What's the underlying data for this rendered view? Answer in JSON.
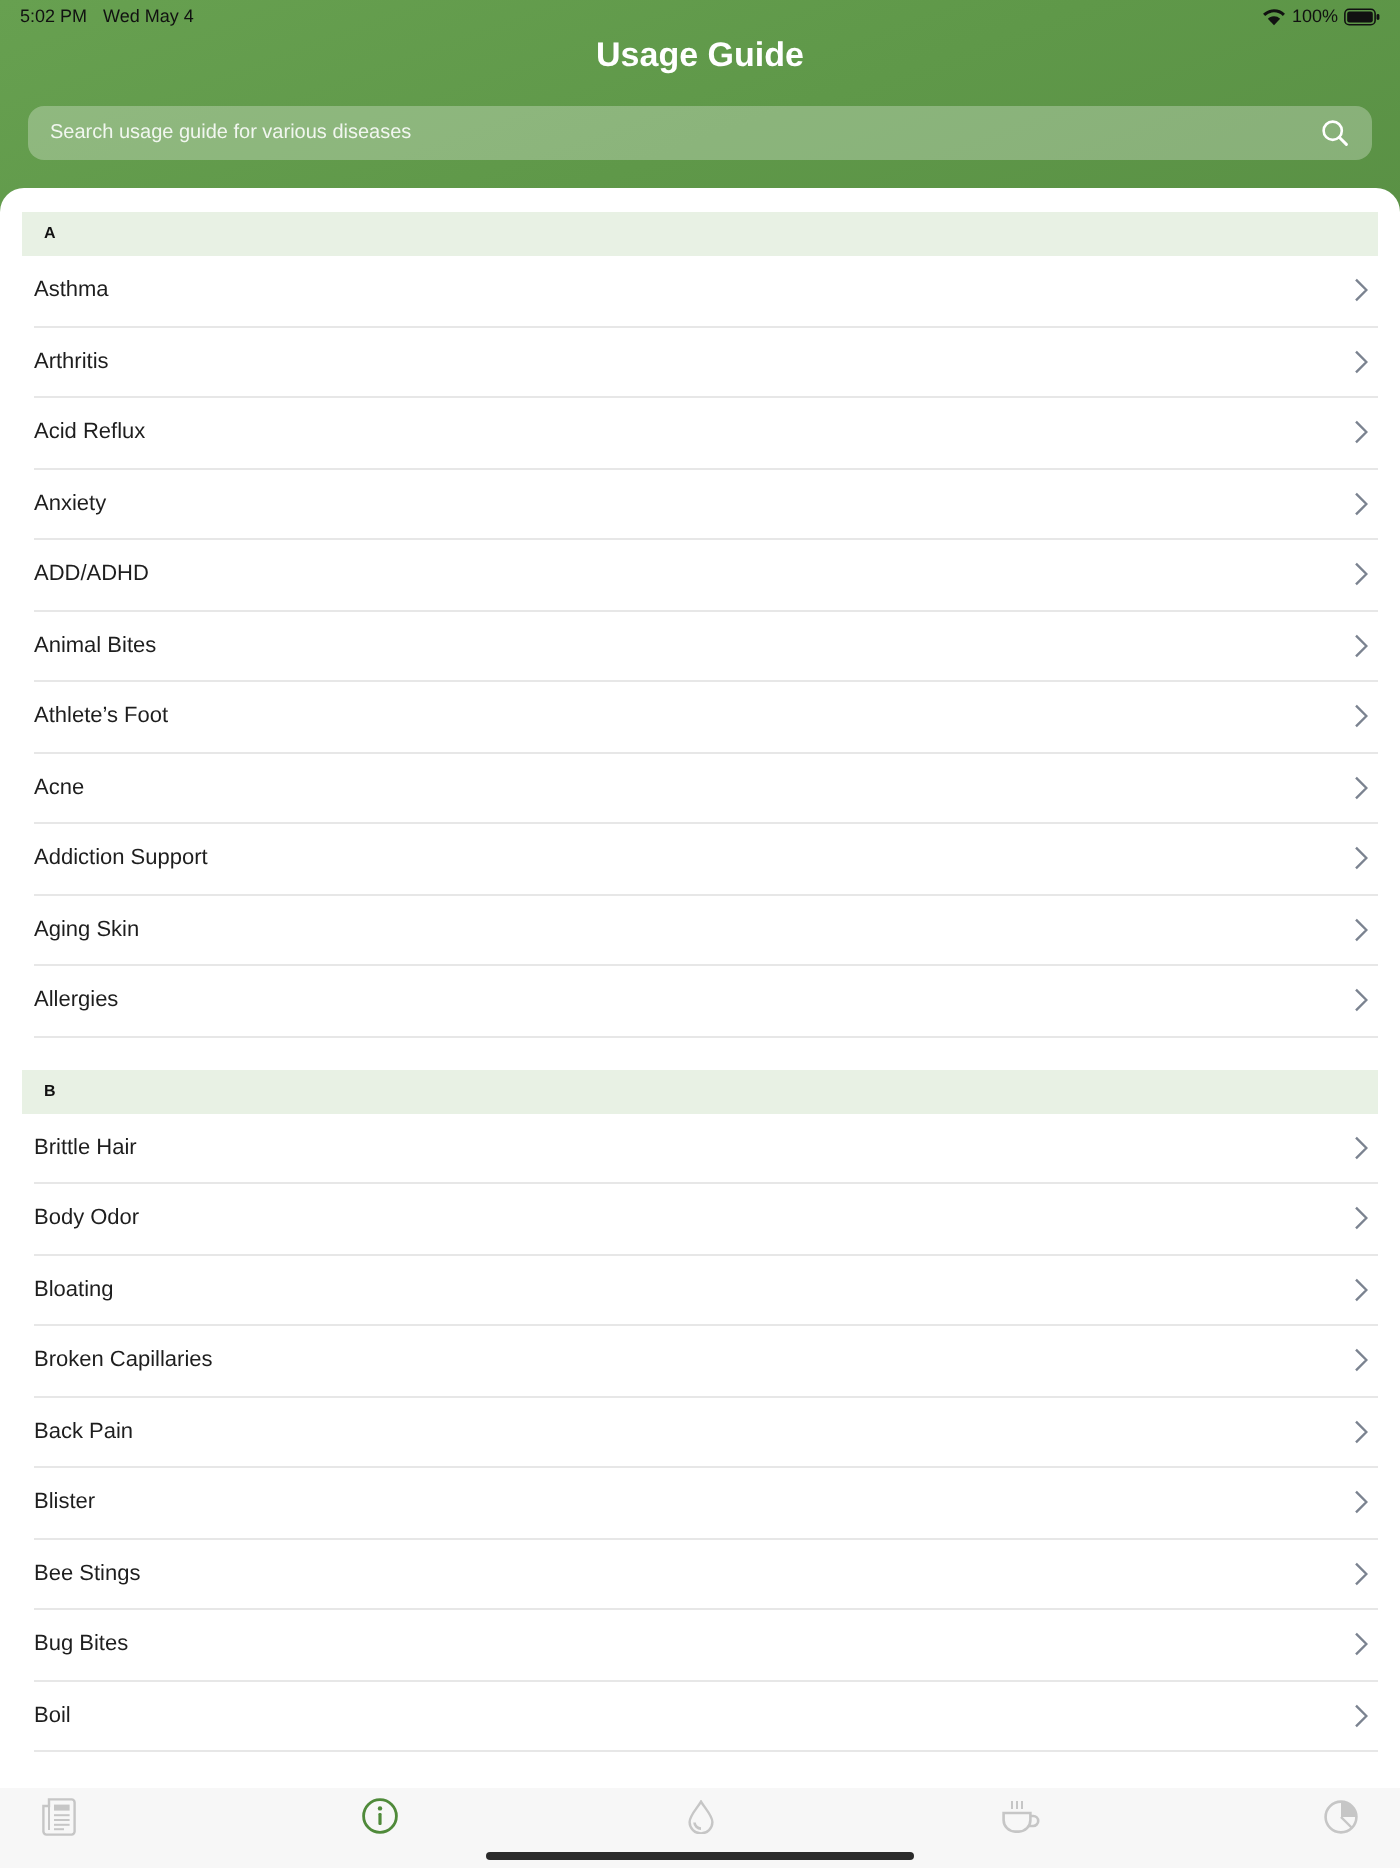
{
  "status_bar": {
    "time": "5:02 PM",
    "date": "Wed May 4",
    "battery": "100%"
  },
  "header": {
    "title": "Usage Guide"
  },
  "search": {
    "placeholder": "Search usage guide for various diseases"
  },
  "sections": [
    {
      "letter": "A",
      "items": [
        "Asthma",
        "Arthritis",
        "Acid Reflux",
        "Anxiety",
        "ADD/ADHD",
        "Animal Bites",
        "Athlete’s Foot",
        "Acne",
        "Addiction Support",
        "Aging Skin",
        "Allergies"
      ]
    },
    {
      "letter": "B",
      "items": [
        "Brittle Hair",
        "Body Odor",
        "Bloating",
        "Broken Capillaries",
        "Back Pain",
        "Blister",
        "Bee Stings",
        "Bug Bites",
        "Boil"
      ]
    }
  ],
  "tab_bar": [
    {
      "kind": "document",
      "selected": false
    },
    {
      "kind": "info",
      "selected": true
    },
    {
      "kind": "drop",
      "selected": false
    },
    {
      "kind": "cup",
      "selected": false
    },
    {
      "kind": "pie",
      "selected": false
    }
  ]
}
